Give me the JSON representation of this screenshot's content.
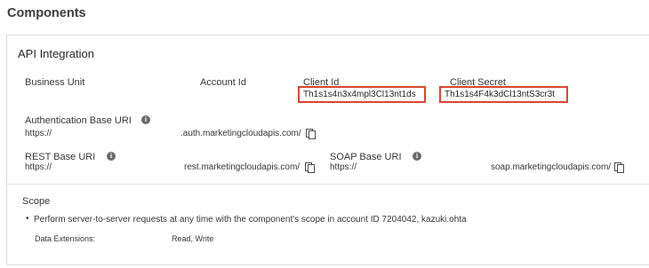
{
  "page_title": "Components",
  "panel": {
    "title": "API Integration",
    "fields": {
      "business_unit_label": "Business Unit",
      "account_id_label": "Account Id",
      "client_id_label": "Client Id",
      "client_id_value": "Th1s1s4n3x4mpl3Cl13nt1ds",
      "client_secret_label": "Client Secret",
      "client_secret_value": "Th1s1s4F4k3dCl13ntS3cr3t",
      "auth_base_uri_label": "Authentication Base URI",
      "auth_base_uri_prefix": "https://",
      "auth_base_uri_suffix": ".auth.marketingcloudapis.com/",
      "rest_base_uri_label": "REST Base URI",
      "rest_base_uri_prefix": "https://",
      "rest_base_uri_suffix": "rest.marketingcloudapis.com/",
      "soap_base_uri_label": "SOAP Base URI",
      "soap_base_uri_prefix": "https://",
      "soap_base_uri_suffix": "soap.marketingcloudapis.com/"
    },
    "highlight_color": "#d9442f"
  },
  "scope": {
    "title": "Scope",
    "bullet_text": "Perform server-to-server requests at any time with the component's scope in account ID 7204042, kazuki.ohta",
    "data_extensions_label": "Data Extensions:",
    "data_extensions_value": "Read, Write"
  },
  "icons": {
    "info": "info-icon",
    "copy": "copy-icon"
  }
}
